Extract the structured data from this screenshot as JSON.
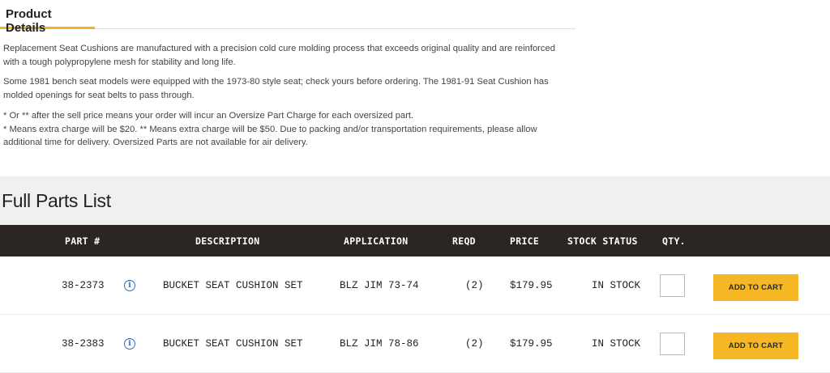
{
  "product_details": {
    "tab_label": "Product Details",
    "paragraphs": [
      "Replacement Seat Cushions are manufactured with a precision cold cure molding process that exceeds original quality and are reinforced with a tough polypropylene mesh for stability and long life.",
      "Some 1981 bench seat models were equipped with the 1973-80 style seat; check yours before ordering. The 1981-91 Seat Cushion has molded openings for seat belts to pass through."
    ],
    "oversize_note_1": "* Or ** after the sell price means your order will incur an Oversize Part Charge for each oversized part.",
    "oversize_note_2": "* Means extra charge will be $20. ** Means extra charge will be $50. Due to packing and/or transportation requirements, please allow additional time for delivery. Oversized Parts are not available for air delivery."
  },
  "parts_list": {
    "title": "Full Parts List",
    "columns": {
      "part": "PART #",
      "description": "DESCRIPTION",
      "application": "APPLICATION",
      "reqd": "REQD",
      "price": "PRICE",
      "stock": "STOCK STATUS",
      "qty": "QTY."
    },
    "info_glyph": "i",
    "rows": [
      {
        "part": "38-2373",
        "description": "BUCKET SEAT CUSHION SET",
        "application": "BLZ JIM 73-74",
        "reqd": "(2)",
        "price": "$179.95",
        "stock": "IN STOCK",
        "qty": "",
        "button": "ADD TO CART"
      },
      {
        "part": "38-2383",
        "description": "BUCKET SEAT CUSHION SET",
        "application": "BLZ JIM 78-86",
        "reqd": "(2)",
        "price": "$179.95",
        "stock": "IN STOCK",
        "qty": "",
        "button": "ADD TO CART"
      }
    ]
  },
  "colors": {
    "accent": "#f2b51b",
    "button": "#f5b723",
    "table_header": "#2b2524",
    "info_icon": "#2a6db5",
    "section_bg": "#f0f0f0"
  }
}
